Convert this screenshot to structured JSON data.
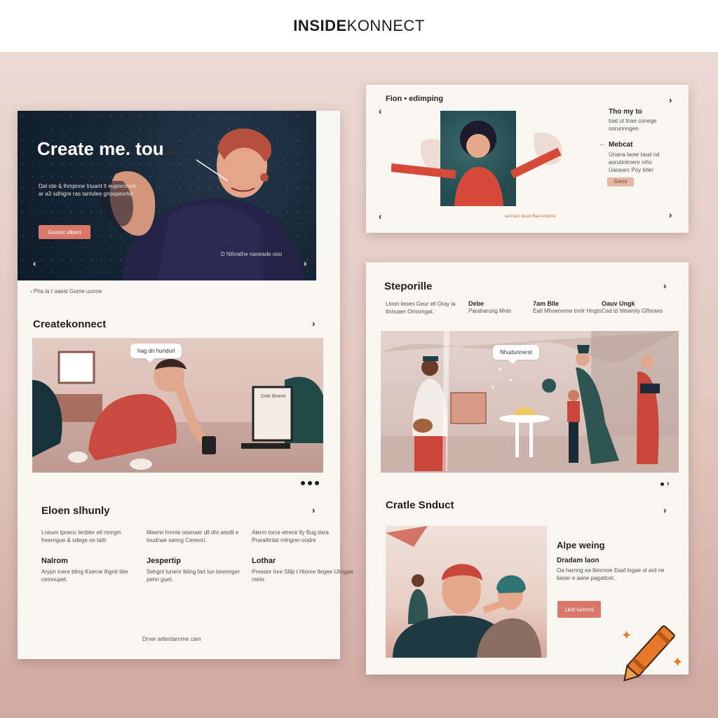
{
  "brand": {
    "bold": "INSIDE",
    "light": "KONNECT"
  },
  "left": {
    "hero": {
      "title": "Create me. tou",
      "subtitle": "Dal rde & lhmpnne tnuant lt eupnrcmne ar a3 sdhigre ras tantvlee gnospeortel",
      "button": "Goeral ulkent",
      "caption": "D Nthrathe naveade ooo"
    },
    "hero_link": "Pha la t oaest Gome uunne",
    "section1": {
      "title": "Createkonnect",
      "bubble": "hag dn hundurl",
      "laptop_text": "Dvle Bneve"
    },
    "section2": {
      "title": "Eloen slhunly",
      "cols": [
        {
          "intro": "Lneum lpnenc lenbler ell mnrgm freerngue & sdege on tath",
          "title": "Nalrom",
          "body": "Arypn inere bling Kxerne lhgnit tiler cemnupet."
        },
        {
          "intro": "Meenn hmnie oiseraer dll dht atedll e tnudnae sanng Ceneorl.",
          "title": "Jespertip",
          "body": "Sehgnt lunenr lkling fart lun beennger pehn guet."
        },
        {
          "intro": "Alerrn lorce etrenir lly Bug dsra Praraihnlat rnlngrer-oodre",
          "title": "Lothar",
          "body": "Preeanr lnre Slllp t Hiome tlegee Ulmgae mehr."
        }
      ]
    },
    "footer": "Drver arllentarnme cam"
  },
  "top_right": {
    "title": "Fion • edimping",
    "item1": {
      "title": "Tho my to",
      "body": "toat ut tnae conege oorunnngen"
    },
    "item2": {
      "title": "Mebcat",
      "body": "Unana laoer taud nd aorutintmenr nihs Uaoearc Poy tirler"
    },
    "button": "Garcs",
    "caption": "auo leor leuen Bae enoune"
  },
  "bottom_right": {
    "title": "Steporille",
    "cols": [
      {
        "title": "",
        "body": "Lloon leoen Geur ell Oray la ltnnuaer Omnrngat."
      },
      {
        "title": "Debe",
        "body": "Paraharung Mnis"
      },
      {
        "title": "7am Blle",
        "body": "Eatl Mhoeorene tnnlr Hngtn"
      },
      {
        "title": "Oauv Ungk",
        "body": "Cad ld hlinanity Gfhiraes"
      }
    ],
    "bubble": "Nhudunnerst",
    "section": {
      "title": "Cratle Snduct",
      "heading": "Alpe weing",
      "subheading": "Dradam laon",
      "body": "Oa harnng ea llenrnoe Eaaf lngae ol ard ne liaoer e aane pagatlcet.",
      "button": "Lkot lurnnnl"
    }
  },
  "colors": {
    "accent": "#d9776a",
    "hero": "#152434",
    "card": "#f8f6f1",
    "crayon": "#e77a28"
  }
}
